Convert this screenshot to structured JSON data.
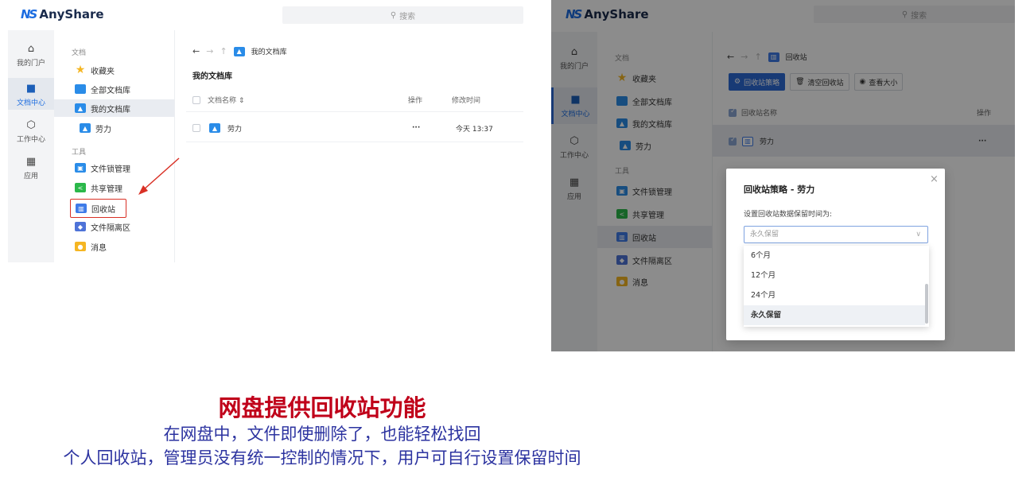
{
  "brand": {
    "name": "AnyShare"
  },
  "left": {
    "search_placeholder": "搜索",
    "rail": [
      {
        "label": "我的门户",
        "icon": "home-icon"
      },
      {
        "label": "文档中心",
        "icon": "folder-icon"
      },
      {
        "label": "工作中心",
        "icon": "cube-icon"
      },
      {
        "label": "应用",
        "icon": "apps-icon"
      }
    ],
    "tree": {
      "docs_heading": "文档",
      "favorites": "收藏夹",
      "all_libs": "全部文档库",
      "my_lib": "我的文档库",
      "user_folder": "劳力",
      "tools_heading": "工具",
      "file_lock": "文件锁管理",
      "share_mgmt": "共享管理",
      "recycle_bin": "回收站",
      "quarantine": "文件隔离区",
      "messages": "消息"
    },
    "breadcrumb": "我的文档库",
    "page_title": "我的文档库",
    "table": {
      "col_name": "文档名称 ⇕",
      "col_action": "操作",
      "col_modified": "修改时间",
      "rows": [
        {
          "name": "劳力",
          "action": "···",
          "modified": "今天 13:37"
        }
      ]
    }
  },
  "right": {
    "search_placeholder": "搜索",
    "rail": [
      {
        "label": "我的门户"
      },
      {
        "label": "文档中心"
      },
      {
        "label": "工作中心"
      },
      {
        "label": "应用"
      }
    ],
    "tree": {
      "docs_heading": "文档",
      "favorites": "收藏夹",
      "all_libs": "全部文档库",
      "my_lib": "我的文档库",
      "user_folder": "劳力",
      "tools_heading": "工具",
      "file_lock": "文件锁管理",
      "share_mgmt": "共享管理",
      "recycle_bin": "回收站",
      "quarantine": "文件隔离区",
      "messages": "消息"
    },
    "breadcrumb": "回收站",
    "toolbar": {
      "policy": "回收站策略",
      "empty": "清空回收站",
      "size": "查看大小"
    },
    "table": {
      "col_name": "回收站名称",
      "col_action": "操作",
      "rows": [
        {
          "name": "劳力",
          "action": "···"
        }
      ]
    },
    "modal": {
      "title": "回收站策略 - 劳力",
      "label": "设置回收站数据保留时间为:",
      "select_value": "永久保留",
      "options": [
        "6个月",
        "12个月",
        "24个月",
        "永久保留"
      ],
      "selected_index": 3
    }
  },
  "caption": {
    "title": "网盘提供回收站功能",
    "line1": "在网盘中，文件即使删除了，也能轻松找回",
    "line2": "个人回收站，管理员没有统一控制的情况下，用户可自行设置保留时间"
  },
  "colors": {
    "accent": "#2d6ad6",
    "highlight": "#d93025",
    "caption_title": "#c0001a",
    "caption_text": "#2c33a0"
  }
}
